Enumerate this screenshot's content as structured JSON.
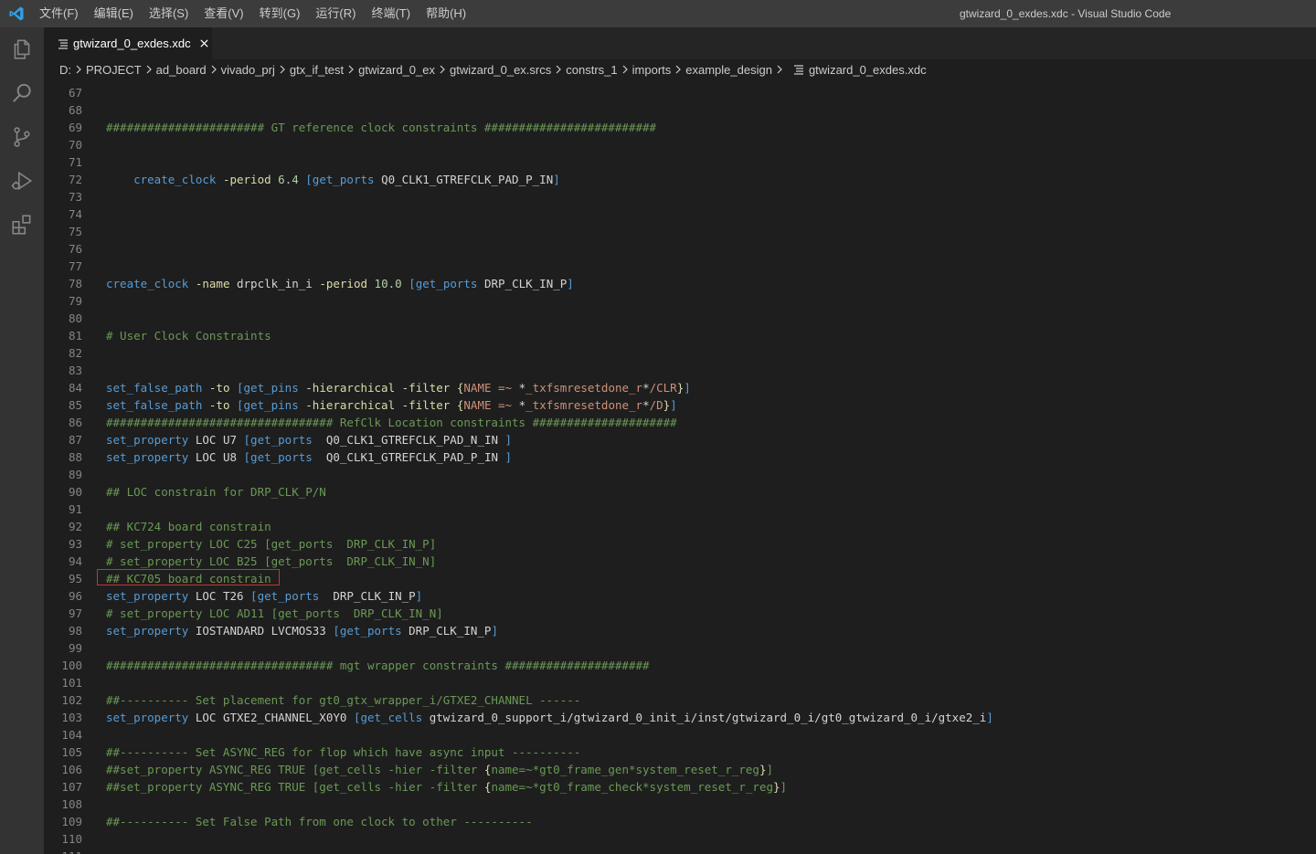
{
  "window": {
    "title": "gtwizard_0_exdes.xdc - Visual Studio Code"
  },
  "menu": [
    "文件(F)",
    "编辑(E)",
    "选择(S)",
    "查看(V)",
    "转到(G)",
    "运行(R)",
    "终端(T)",
    "帮助(H)"
  ],
  "activity_bar": [
    "explorer-icon",
    "search-icon",
    "source-control-icon",
    "run-debug-icon",
    "extensions-icon"
  ],
  "tab": {
    "label": "gtwizard_0_exdes.xdc"
  },
  "breadcrumb": [
    "D:",
    "PROJECT",
    "ad_board",
    "vivado_prj",
    "gtx_if_test",
    "gtwizard_0_ex",
    "gtwizard_0_ex.srcs",
    "constrs_1",
    "imports",
    "example_design",
    "gtwizard_0_exdes.xdc"
  ],
  "highlighted_line": 95,
  "lines": [
    {
      "n": "67",
      "tokens": []
    },
    {
      "n": "68",
      "tokens": []
    },
    {
      "n": "69",
      "tokens": [
        [
          "c",
          "####################### GT reference clock constraints #########################"
        ]
      ]
    },
    {
      "n": "70",
      "tokens": []
    },
    {
      "n": "71",
      "tokens": []
    },
    {
      "n": "72",
      "tokens": [
        [
          "p",
          "    "
        ],
        [
          "k",
          "create_clock"
        ],
        [
          "p",
          " "
        ],
        [
          "o",
          "-period"
        ],
        [
          "p",
          " "
        ],
        [
          "n",
          "6.4"
        ],
        [
          "p",
          " "
        ],
        [
          "b",
          "[get_ports"
        ],
        [
          "p",
          " Q0_CLK1_GTREFCLK_PAD_P_IN"
        ],
        [
          "b",
          "]"
        ]
      ]
    },
    {
      "n": "73",
      "tokens": []
    },
    {
      "n": "74",
      "tokens": []
    },
    {
      "n": "75",
      "tokens": []
    },
    {
      "n": "76",
      "tokens": []
    },
    {
      "n": "77",
      "tokens": []
    },
    {
      "n": "78",
      "tokens": [
        [
          "k",
          "create_clock"
        ],
        [
          "p",
          " "
        ],
        [
          "o",
          "-name"
        ],
        [
          "p",
          " drpclk_in_i "
        ],
        [
          "o",
          "-period"
        ],
        [
          "p",
          " "
        ],
        [
          "n",
          "10.0"
        ],
        [
          "p",
          " "
        ],
        [
          "b",
          "[get_ports"
        ],
        [
          "p",
          " DRP_CLK_IN_P"
        ],
        [
          "b",
          "]"
        ]
      ]
    },
    {
      "n": "79",
      "tokens": []
    },
    {
      "n": "80",
      "tokens": []
    },
    {
      "n": "81",
      "tokens": [
        [
          "c",
          "# User Clock Constraints"
        ]
      ]
    },
    {
      "n": "82",
      "tokens": []
    },
    {
      "n": "83",
      "tokens": []
    },
    {
      "n": "84",
      "tokens": [
        [
          "k",
          "set_false_path"
        ],
        [
          "p",
          " "
        ],
        [
          "o",
          "-to"
        ],
        [
          "p",
          " "
        ],
        [
          "b",
          "[get_pins"
        ],
        [
          "p",
          " "
        ],
        [
          "o",
          "-hierarchical"
        ],
        [
          "p",
          " "
        ],
        [
          "o",
          "-filter"
        ],
        [
          "p",
          " "
        ],
        [
          "o",
          "{"
        ],
        [
          "s",
          "NAME =~ "
        ],
        [
          "p",
          "*"
        ],
        [
          "s",
          "_txfsmresetdone_r"
        ],
        [
          "p",
          "*"
        ],
        [
          "s",
          "/CLR"
        ],
        [
          "o",
          "}"
        ],
        [
          "b",
          "]"
        ]
      ]
    },
    {
      "n": "85",
      "tokens": [
        [
          "k",
          "set_false_path"
        ],
        [
          "p",
          " "
        ],
        [
          "o",
          "-to"
        ],
        [
          "p",
          " "
        ],
        [
          "b",
          "[get_pins"
        ],
        [
          "p",
          " "
        ],
        [
          "o",
          "-hierarchical"
        ],
        [
          "p",
          " "
        ],
        [
          "o",
          "-filter"
        ],
        [
          "p",
          " "
        ],
        [
          "o",
          "{"
        ],
        [
          "s",
          "NAME =~ "
        ],
        [
          "p",
          "*"
        ],
        [
          "s",
          "_txfsmresetdone_r"
        ],
        [
          "p",
          "*"
        ],
        [
          "s",
          "/D"
        ],
        [
          "o",
          "}"
        ],
        [
          "b",
          "]"
        ]
      ]
    },
    {
      "n": "86",
      "tokens": [
        [
          "c",
          "################################# RefClk Location constraints #####################"
        ]
      ]
    },
    {
      "n": "87",
      "tokens": [
        [
          "k",
          "set_property"
        ],
        [
          "p",
          " LOC U7 "
        ],
        [
          "b",
          "[get_ports"
        ],
        [
          "p",
          "  Q0_CLK1_GTREFCLK_PAD_N_IN "
        ],
        [
          "b",
          "]"
        ]
      ]
    },
    {
      "n": "88",
      "tokens": [
        [
          "k",
          "set_property"
        ],
        [
          "p",
          " LOC U8 "
        ],
        [
          "b",
          "[get_ports"
        ],
        [
          "p",
          "  Q0_CLK1_GTREFCLK_PAD_P_IN "
        ],
        [
          "b",
          "]"
        ]
      ]
    },
    {
      "n": "89",
      "tokens": []
    },
    {
      "n": "90",
      "tokens": [
        [
          "c",
          "## LOC constrain for DRP_CLK_P/N"
        ]
      ]
    },
    {
      "n": "91",
      "tokens": []
    },
    {
      "n": "92",
      "tokens": [
        [
          "c",
          "## KC724 board constrain"
        ]
      ]
    },
    {
      "n": "93",
      "tokens": [
        [
          "c",
          "# set_property LOC C25 [get_ports  DRP_CLK_IN_P]"
        ]
      ]
    },
    {
      "n": "94",
      "tokens": [
        [
          "c",
          "# set_property LOC B25 [get_ports  DRP_CLK_IN_N]"
        ]
      ]
    },
    {
      "n": "95",
      "tokens": [
        [
          "c",
          "## KC705 board constrain"
        ]
      ]
    },
    {
      "n": "96",
      "tokens": [
        [
          "k",
          "set_property"
        ],
        [
          "p",
          " LOC T26 "
        ],
        [
          "b",
          "[get_ports"
        ],
        [
          "p",
          "  DRP_CLK_IN_P"
        ],
        [
          "b",
          "]"
        ]
      ]
    },
    {
      "n": "97",
      "tokens": [
        [
          "c",
          "# set_property LOC AD11 [get_ports  DRP_CLK_IN_N]"
        ]
      ]
    },
    {
      "n": "98",
      "tokens": [
        [
          "k",
          "set_property"
        ],
        [
          "p",
          " IOSTANDARD LVCMOS33 "
        ],
        [
          "b",
          "[get_ports"
        ],
        [
          "p",
          " DRP_CLK_IN_P"
        ],
        [
          "b",
          "]"
        ]
      ]
    },
    {
      "n": "99",
      "tokens": []
    },
    {
      "n": "100",
      "tokens": [
        [
          "c",
          "################################# mgt wrapper constraints #####################"
        ]
      ]
    },
    {
      "n": "101",
      "tokens": []
    },
    {
      "n": "102",
      "tokens": [
        [
          "c",
          "##---------- Set placement for gt0_gtx_wrapper_i/GTXE2_CHANNEL ------"
        ]
      ]
    },
    {
      "n": "103",
      "tokens": [
        [
          "k",
          "set_property"
        ],
        [
          "p",
          " LOC GTXE2_CHANNEL_X0Y0 "
        ],
        [
          "b",
          "[get_cells"
        ],
        [
          "p",
          " gtwizard_0_support_i/gtwizard_0_init_i/inst/gtwizard_0_i/gt0_gtwizard_0_i/gtxe2_i"
        ],
        [
          "b",
          "]"
        ]
      ]
    },
    {
      "n": "104",
      "tokens": []
    },
    {
      "n": "105",
      "tokens": [
        [
          "c",
          "##---------- Set ASYNC_REG for flop which have async input ----------"
        ]
      ]
    },
    {
      "n": "106",
      "tokens": [
        [
          "c",
          "##set_property ASYNC_REG TRUE [get_cells -hier -filter "
        ],
        [
          "o",
          "{"
        ],
        [
          "c",
          "name=~*gt0_frame_gen*system_reset_r_reg"
        ],
        [
          "o",
          "}"
        ],
        [
          "c",
          "]"
        ]
      ]
    },
    {
      "n": "107",
      "tokens": [
        [
          "c",
          "##set_property ASYNC_REG TRUE [get_cells -hier -filter "
        ],
        [
          "o",
          "{"
        ],
        [
          "c",
          "name=~*gt0_frame_check*system_reset_r_reg"
        ],
        [
          "o",
          "}"
        ],
        [
          "c",
          "]"
        ]
      ]
    },
    {
      "n": "108",
      "tokens": []
    },
    {
      "n": "109",
      "tokens": [
        [
          "c",
          "##---------- Set False Path from one clock to other ----------"
        ]
      ]
    },
    {
      "n": "110",
      "tokens": []
    },
    {
      "n": "111",
      "tokens": []
    }
  ]
}
